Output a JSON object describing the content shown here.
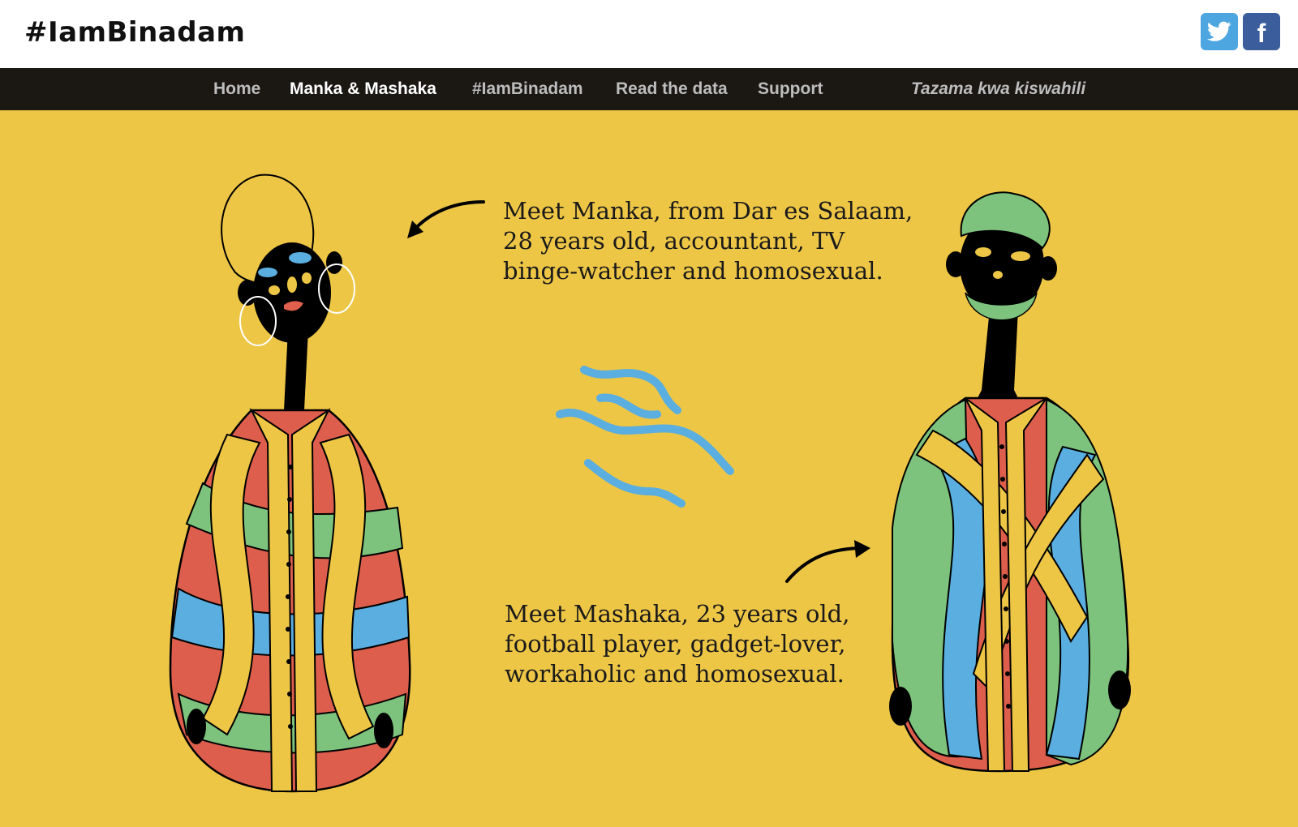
{
  "header": {
    "logo_text": "#IamBinadam",
    "social": [
      {
        "name": "twitter",
        "color": "#4ea6e0"
      },
      {
        "name": "facebook",
        "color": "#3b5d9b",
        "glyph": "f"
      }
    ]
  },
  "nav": {
    "items": [
      {
        "label": "Home",
        "active": false
      },
      {
        "label": "Manka & Mashaka",
        "active": true
      },
      {
        "label": "#IamBinadam",
        "active": false
      },
      {
        "label": "Read the data",
        "active": false
      },
      {
        "label": "Support",
        "active": false
      }
    ],
    "language_link": "Tazama kwa kiswahili"
  },
  "hero": {
    "background": "#eec646",
    "manka_caption": [
      "Meet Manka, from Dar es Salaam,",
      "28 years old, accountant, TV",
      "binge-watcher and homosexual."
    ],
    "mashaka_caption": [
      "Meet Mashaka, 23 years old,",
      "football player, gadget-lover,",
      "workaholic and homosexual."
    ]
  }
}
